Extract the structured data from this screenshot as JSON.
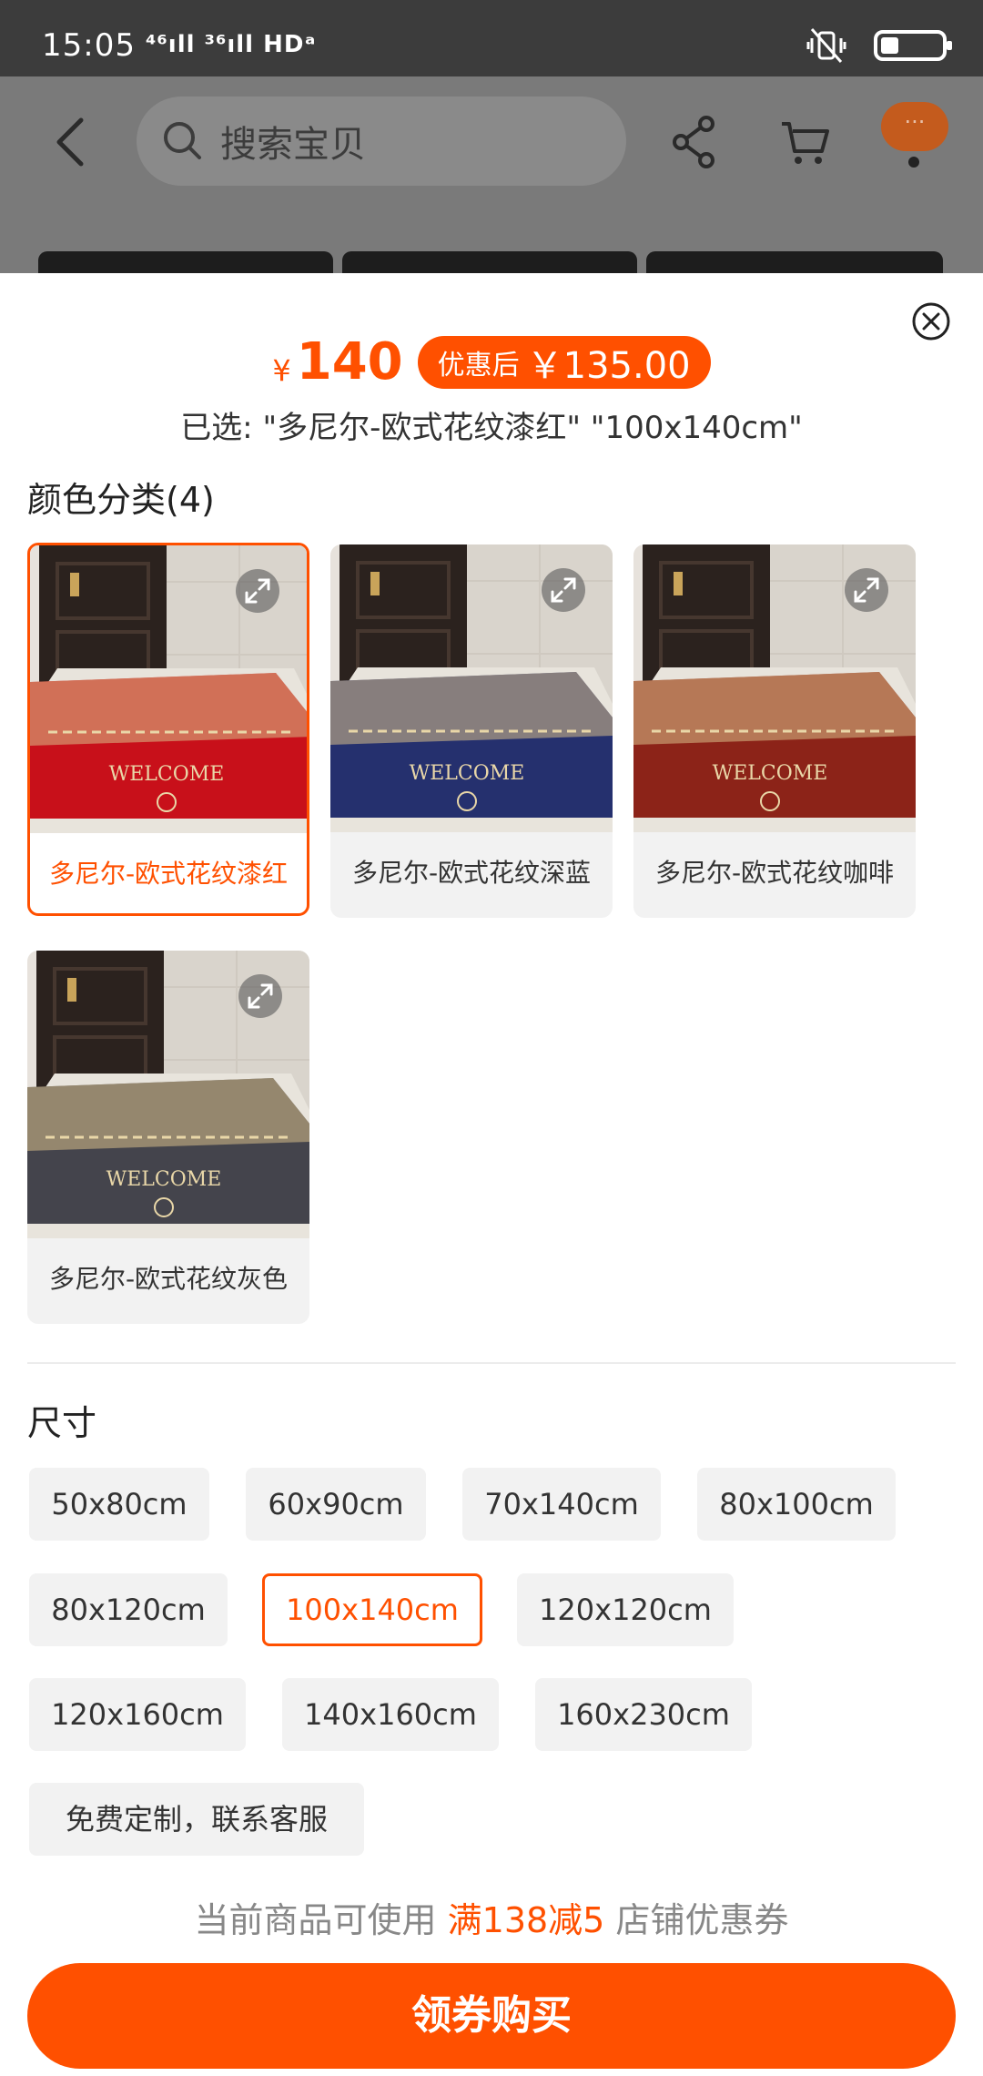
{
  "status_bar": {
    "time": "15:05",
    "signal": "⁴⁶ıll ³⁶ıll HDᵃ",
    "battery_level": 0.3
  },
  "header": {
    "search_placeholder": "搜索宝贝",
    "more_label": "···"
  },
  "sheet": {
    "price_symbol": "¥",
    "price": "140",
    "promo_label": "优惠后",
    "promo_price": "￥135.00",
    "selected_text": "已选: \"多尼尔-欧式花纹漆红\" \"100x140cm\"",
    "color_section_title": "颜色分类(4)",
    "colors": [
      {
        "label": "多尼尔-欧式花纹漆红",
        "selected": true,
        "rug_color": "#c8101a"
      },
      {
        "label": "多尼尔-欧式花纹深蓝",
        "selected": false,
        "rug_color": "#25306e"
      },
      {
        "label": "多尼尔-欧式花纹咖啡",
        "selected": false,
        "rug_color": "#8c2318"
      },
      {
        "label": "多尼尔-欧式花纹灰色",
        "selected": false,
        "rug_color": "#44444c"
      }
    ],
    "size_section_title": "尺寸",
    "sizes": [
      {
        "label": "50x80cm",
        "selected": false
      },
      {
        "label": "60x90cm",
        "selected": false
      },
      {
        "label": "70x140cm",
        "selected": false
      },
      {
        "label": "80x100cm",
        "selected": false
      },
      {
        "label": "80x120cm",
        "selected": false
      },
      {
        "label": "100x140cm",
        "selected": true
      },
      {
        "label": "120x120cm",
        "selected": false
      },
      {
        "label": "120x160cm",
        "selected": false
      },
      {
        "label": "140x160cm",
        "selected": false
      },
      {
        "label": "160x230cm",
        "selected": false
      },
      {
        "label": "免费定制，联系客服",
        "selected": false
      }
    ],
    "coupon_prefix": "当前商品可使用",
    "coupon_highlight": "满138减5",
    "coupon_suffix": "店铺优惠券",
    "buy_button": "领券购买"
  },
  "colors": {
    "accent": "#ff5000",
    "statusbar": "#3c3c3c",
    "overlay": "#7a7a7a"
  }
}
